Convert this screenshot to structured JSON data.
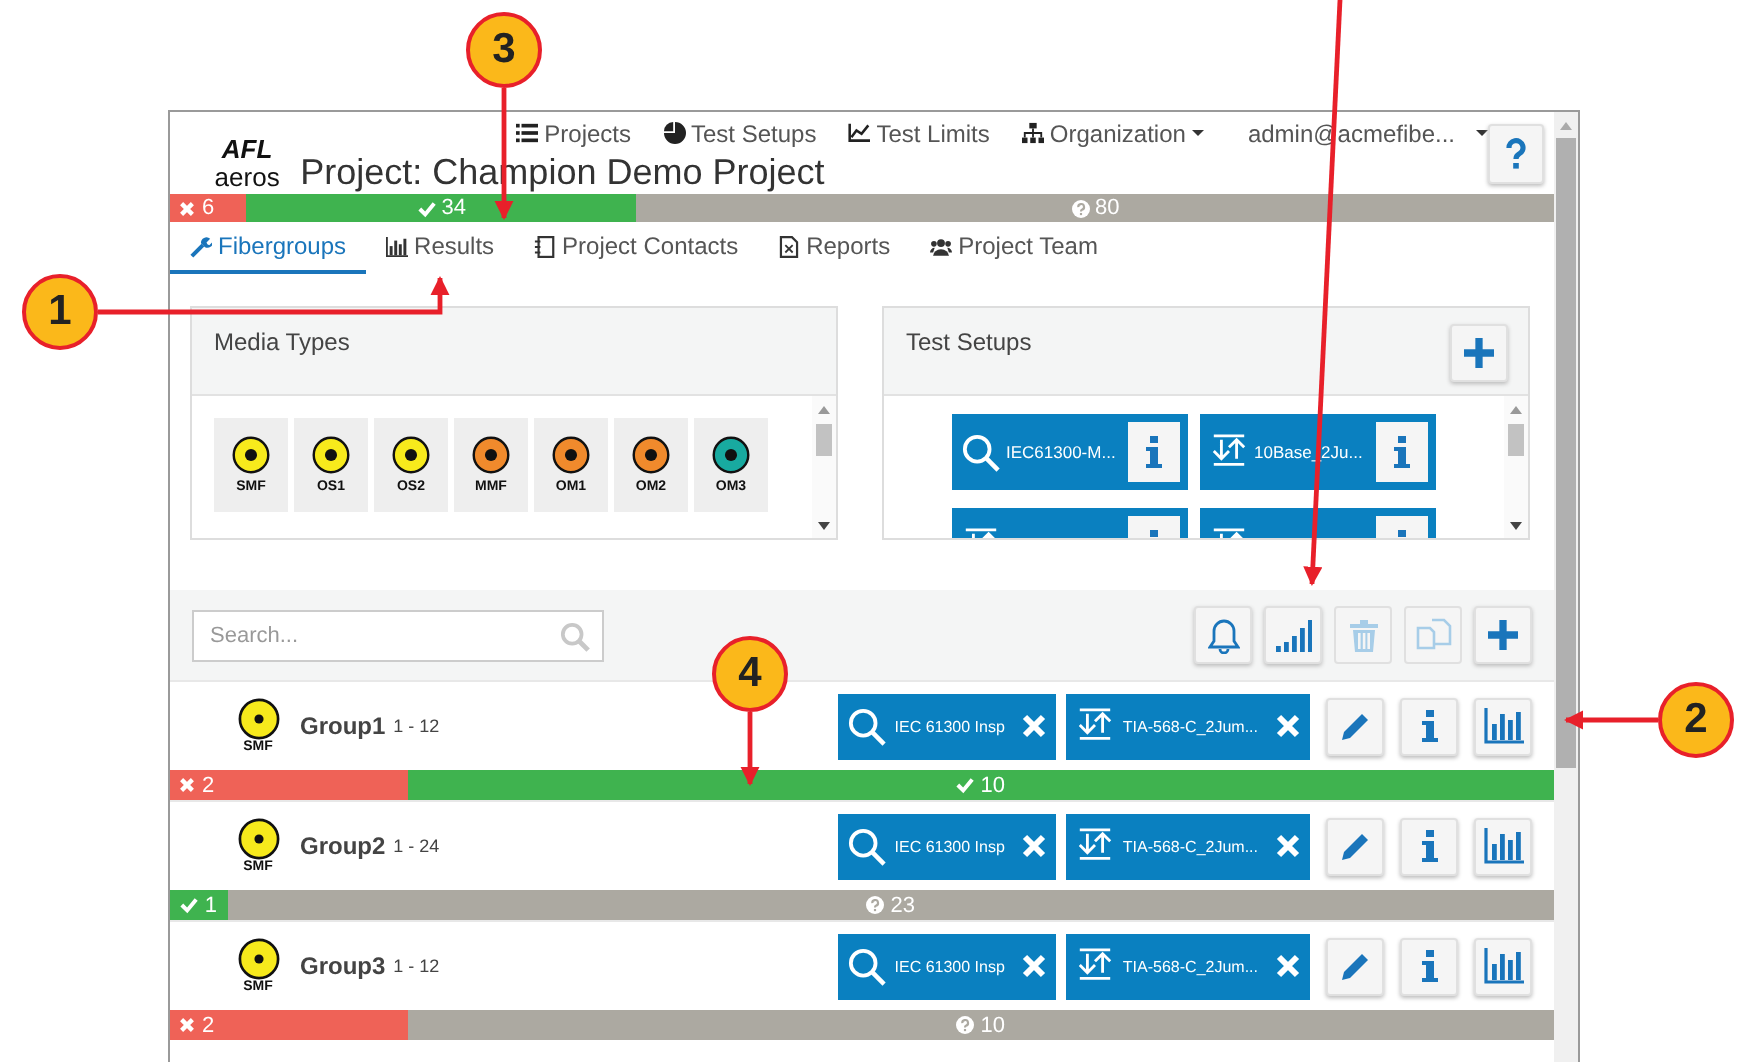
{
  "header": {
    "logo": {
      "brand": "AFL",
      "product": "aeros"
    },
    "title": "Project: Champion Demo Project",
    "nav": [
      {
        "label": "Projects",
        "dropdown": false
      },
      {
        "label": "Test Setups",
        "dropdown": false
      },
      {
        "label": "Test Limits",
        "dropdown": false
      },
      {
        "label": "Organization",
        "dropdown": true
      }
    ],
    "user": {
      "label": "admin@acmefibe...",
      "dropdown": true
    }
  },
  "summary": [
    {
      "kind": "fail",
      "count": "6"
    },
    {
      "kind": "pass",
      "count": "34"
    },
    {
      "kind": "untested",
      "count": "80"
    }
  ],
  "tabs": [
    {
      "label": "Fibergroups",
      "selected": true
    },
    {
      "label": "Results",
      "selected": false
    },
    {
      "label": "Project Contacts",
      "selected": false
    },
    {
      "label": "Reports",
      "selected": false
    },
    {
      "label": "Project Team",
      "selected": false
    }
  ],
  "media_types": {
    "title": "Media Types",
    "items": [
      {
        "label": "SMF",
        "color": "#f7ea1c"
      },
      {
        "label": "OS1",
        "color": "#f7ea1c"
      },
      {
        "label": "OS2",
        "color": "#f7ea1c"
      },
      {
        "label": "MMF",
        "color": "#f08a2c"
      },
      {
        "label": "OM1",
        "color": "#f08a2c"
      },
      {
        "label": "OM2",
        "color": "#f08a2c"
      },
      {
        "label": "OM3",
        "color": "#18aaa0"
      }
    ]
  },
  "test_setups": {
    "title": "Test Setups",
    "items": [
      {
        "kind": "inspect",
        "label": "IEC61300-M..."
      },
      {
        "kind": "loss",
        "label": "10Base_2Ju..."
      },
      {
        "kind": "loss"
      },
      {
        "kind": "loss"
      }
    ]
  },
  "toolbar": {
    "search_placeholder": "Search...",
    "buttons": [
      {
        "kind": "bell",
        "disabled": false
      },
      {
        "kind": "signal",
        "disabled": false
      },
      {
        "kind": "trash",
        "disabled": true
      },
      {
        "kind": "copy",
        "disabled": true
      },
      {
        "kind": "plus",
        "disabled": false
      }
    ]
  },
  "groups": [
    {
      "name": "Group1",
      "range": "1 - 12",
      "media": "SMF",
      "color": "#f7ea1c",
      "setups": [
        {
          "kind": "inspect",
          "label": "IEC 61300 Insp"
        },
        {
          "kind": "loss",
          "label": "TIA-568-C_2Jum..."
        }
      ],
      "results": [
        {
          "kind": "fail",
          "count": "2"
        },
        {
          "kind": "pass",
          "count": "10"
        }
      ]
    },
    {
      "name": "Group2",
      "range": "1 - 24",
      "media": "SMF",
      "color": "#f7ea1c",
      "setups": [
        {
          "kind": "inspect",
          "label": "IEC 61300 Insp"
        },
        {
          "kind": "loss",
          "label": "TIA-568-C_2Jum..."
        }
      ],
      "results": [
        {
          "kind": "pass",
          "count": "1"
        },
        {
          "kind": "untested",
          "count": "23"
        }
      ]
    },
    {
      "name": "Group3",
      "range": "1 - 12",
      "media": "SMF",
      "color": "#f7ea1c",
      "setups": [
        {
          "kind": "inspect",
          "label": "IEC 61300 Insp"
        },
        {
          "kind": "loss",
          "label": "TIA-568-C_2Jum..."
        }
      ],
      "results": [
        {
          "kind": "fail",
          "count": "2"
        },
        {
          "kind": "untested",
          "count": "10"
        }
      ]
    }
  ],
  "callouts": [
    {
      "number": "1"
    },
    {
      "number": "2"
    },
    {
      "number": "3"
    },
    {
      "number": "4"
    }
  ]
}
